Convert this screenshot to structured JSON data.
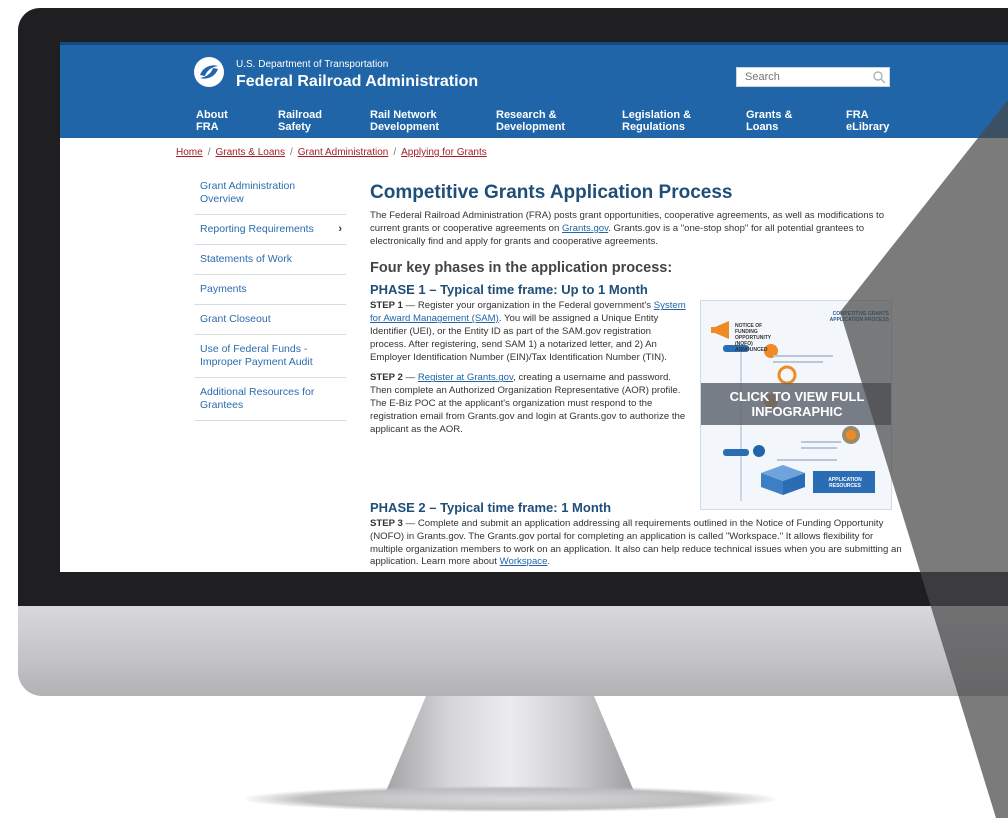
{
  "header": {
    "department": "U.S. Department of Transportation",
    "agency": "Federal Railroad Administration",
    "search_placeholder": "Search"
  },
  "nav": {
    "about": [
      "About",
      "FRA"
    ],
    "safety": [
      "Railroad",
      "Safety"
    ],
    "network": [
      "Rail Network",
      "Development"
    ],
    "research": [
      "Research &",
      "Development"
    ],
    "legislation": [
      "Legislation &",
      "Regulations"
    ],
    "grants": [
      "Grants &",
      "Loans"
    ],
    "library": [
      "FRA",
      "eLibrary"
    ]
  },
  "breadcrumb": [
    "Home",
    "Grants & Loans",
    "Grant Administration",
    "Applying for Grants"
  ],
  "sidebar": [
    "Grant Administration Overview",
    "Reporting Requirements",
    "Statements of Work",
    "Payments",
    "Grant Closeout",
    "Use of Federal Funds - Improper Payment Audit",
    "Additional Resources for Grantees"
  ],
  "main": {
    "title": "Competitive Grants Application Process",
    "intro_a": "The Federal Railroad Administration (FRA) posts grant opportunities, cooperative agreements, as well as modifications to current grants or cooperative agreements on ",
    "intro_link": "Grants.gov",
    "intro_b": ". Grants.gov is a \"one-stop shop\" for all potential grantees to electronically find and apply for grants and cooperative agreements.",
    "phases_heading": "Four key phases in the application process:",
    "phase1_title": "PHASE 1 – Typical time frame: Up to 1 Month",
    "step1_label": "STEP 1",
    "step1_a": " — Register your organization in the Federal government's ",
    "step1_link": "System for Award Management (SAM)",
    "step1_b": ". You will be assigned a Unique Entity Identifier (UEI), or the Entity ID as part of the SAM.gov registration process. After registering, send SAM 1) a notarized letter, and 2) An Employer Identification Number (EIN)/Tax Identification Number (TIN).",
    "step2_label": "STEP 2",
    "step2_a": " — ",
    "step2_link": "Register at Grants.gov",
    "step2_b": ", creating a username and password. Then complete an Authorized Organization Representative (AOR) profile. The E-Biz POC at the applicant's organization must respond to the registration email from Grants.gov and login at Grants.gov to authorize the applicant as the AOR.",
    "phase2_title": "PHASE 2 – Typical time frame: 1 Month",
    "step3_label": "STEP 3",
    "step3_a": " — Complete and submit an application addressing all requirements outlined in the Notice of Funding Opportunity (NOFO) in Grants.gov. The Grants.gov portal for completing an application is called \"Workspace.\" It allows flexibility for multiple organization members to work on an application. It also can help reduce technical issues when you are submitting an application. Learn more about ",
    "step3_link": "Workspace",
    "step3_b": "."
  },
  "infographic": {
    "overlay_line1": "CLICK TO VIEW FULL",
    "overlay_line2": "INFOGRAPHIC",
    "title": "COMPETITIVE GRANTS APPLICATION PROCESS",
    "nofo": "NOTICE OF FUNDING OPPORTUNITY (NOFO) ANNOUNCED",
    "resources": "APPLICATION RESOURCES"
  },
  "colors": {
    "header_blue": "#1f65a8",
    "title_blue": "#1f4e79",
    "link_blue": "#1f65a8",
    "breadcrumb_red": "#a31f27",
    "monitor_bezel": "#1f1f21"
  }
}
